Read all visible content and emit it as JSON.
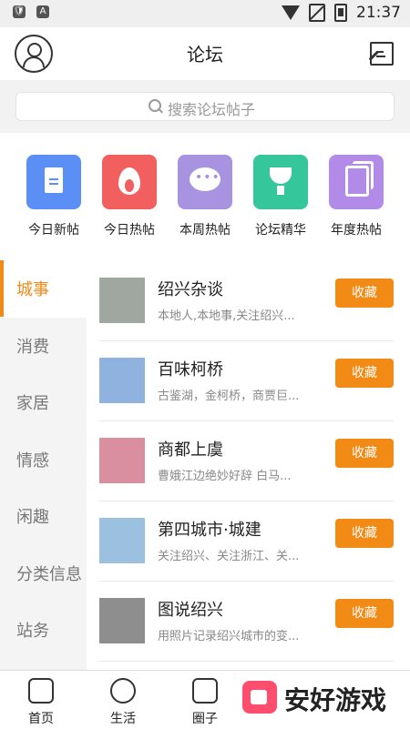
{
  "status_bar": {
    "time": "21:37"
  },
  "header": {
    "title": "论坛"
  },
  "search": {
    "placeholder": "搜索论坛帖子"
  },
  "quick_links": [
    {
      "label": "今日新帖",
      "color": "#5b8ff5",
      "icon": "doc-icon"
    },
    {
      "label": "今日热帖",
      "color": "#f25f5f",
      "icon": "flame-icon"
    },
    {
      "label": "本周热帖",
      "color": "#a893e0",
      "icon": "chat-bubble-icon"
    },
    {
      "label": "论坛精华",
      "color": "#35c79b",
      "icon": "trophy-icon"
    },
    {
      "label": "年度热帖",
      "color": "#b28ae8",
      "icon": "documents-icon"
    }
  ],
  "categories": [
    "城事",
    "消费",
    "家居",
    "情感",
    "闲趣",
    "分类信息",
    "站务"
  ],
  "active_category": "城事",
  "forums": [
    {
      "name": "绍兴杂谈",
      "desc": "本地人,本地事,关注绍兴...",
      "button": "收藏"
    },
    {
      "name": "百味柯桥",
      "desc": "古鉴湖，金柯桥，商贾巨...",
      "button": "收藏"
    },
    {
      "name": "商都上虞",
      "desc": "曹娥江边绝妙好辞 白马...",
      "button": "收藏"
    },
    {
      "name": "第四城市·城建",
      "desc": "关注绍兴、关注浙江、关...",
      "button": "收藏"
    },
    {
      "name": "图说绍兴",
      "desc": "用照片记录绍兴城市的变...",
      "button": "收藏"
    }
  ],
  "bottom_tabs": [
    {
      "label": "首页",
      "icon": "home-icon"
    },
    {
      "label": "生活",
      "icon": "planet-icon"
    },
    {
      "label": "圈子",
      "icon": "camera-icon"
    }
  ],
  "watermark": {
    "text": "安好游戏"
  },
  "colors": {
    "accent": "#f08a18",
    "button": "#f28a16"
  }
}
